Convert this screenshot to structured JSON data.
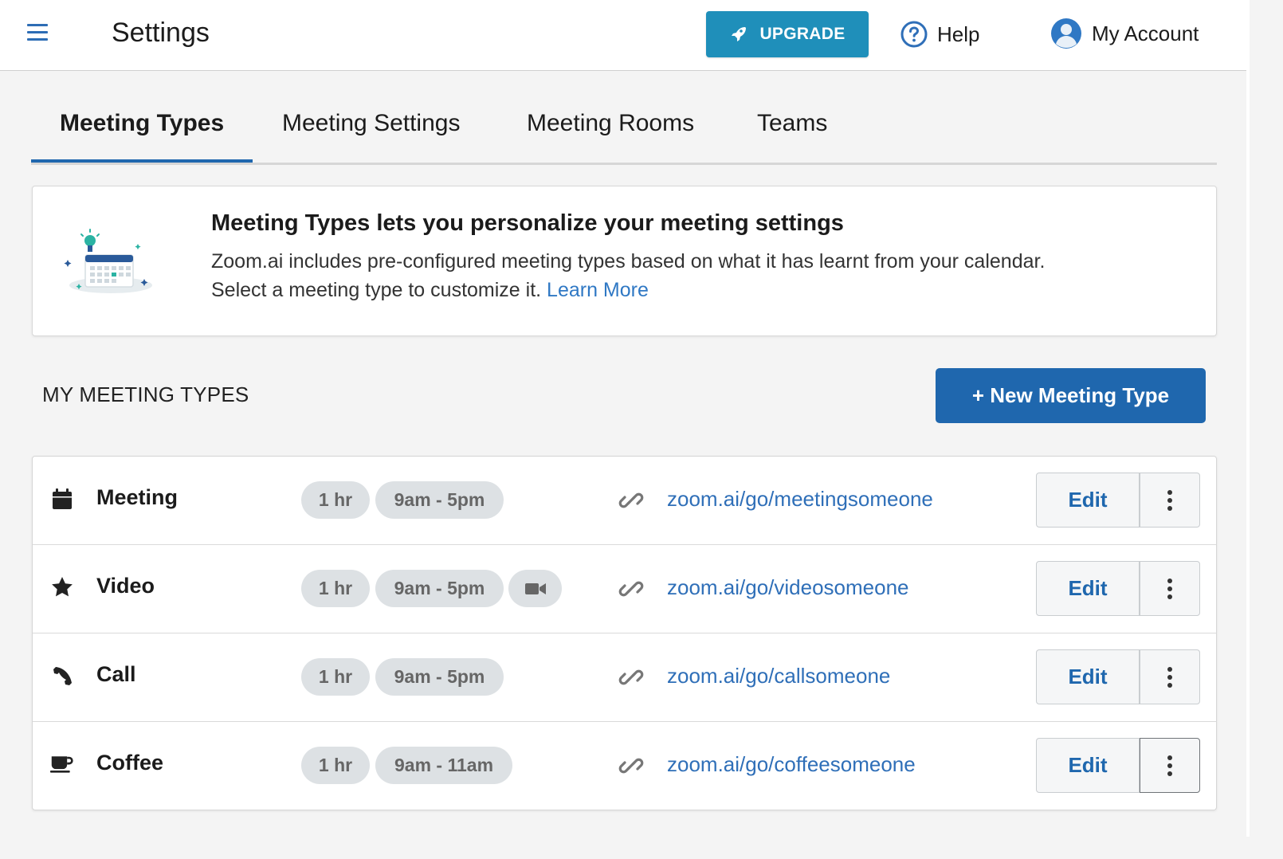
{
  "header": {
    "title": "Settings",
    "upgrade_label": "UPGRADE",
    "help_label": "Help",
    "account_label": "My Account"
  },
  "tabs": [
    {
      "label": "Meeting Types",
      "active": true
    },
    {
      "label": "Meeting Settings",
      "active": false
    },
    {
      "label": "Meeting Rooms",
      "active": false
    },
    {
      "label": "Teams",
      "active": false
    }
  ],
  "info": {
    "title": "Meeting Types lets you personalize your meeting settings",
    "line1": "Zoom.ai includes pre-configured meeting types based on what it has learnt from your calendar.",
    "line2": "Select a meeting type to customize it.",
    "learn_more": "Learn More"
  },
  "section": {
    "label": "MY MEETING TYPES",
    "new_button": "+ New Meeting Type"
  },
  "meeting_types": [
    {
      "name": "Meeting",
      "icon": "calendar-icon",
      "duration": "1 hr",
      "hours": "9am - 5pm",
      "video": false,
      "url": "zoom.ai/go/meetingsomeone",
      "edit": "Edit"
    },
    {
      "name": "Video",
      "icon": "star-icon",
      "duration": "1 hr",
      "hours": "9am - 5pm",
      "video": true,
      "url": "zoom.ai/go/videosomeone",
      "edit": "Edit"
    },
    {
      "name": "Call",
      "icon": "phone-icon",
      "duration": "1 hr",
      "hours": "9am - 5pm",
      "video": false,
      "url": "zoom.ai/go/callsomeone",
      "edit": "Edit"
    },
    {
      "name": "Coffee",
      "icon": "coffee-icon",
      "duration": "1 hr",
      "hours": "9am - 11am",
      "video": false,
      "url": "zoom.ai/go/coffeesomeone",
      "edit": "Edit"
    }
  ],
  "colors": {
    "primary": "#1f67ae",
    "upgrade": "#1f8fba",
    "link": "#2f6fb8",
    "pill_bg": "#dde1e4"
  }
}
